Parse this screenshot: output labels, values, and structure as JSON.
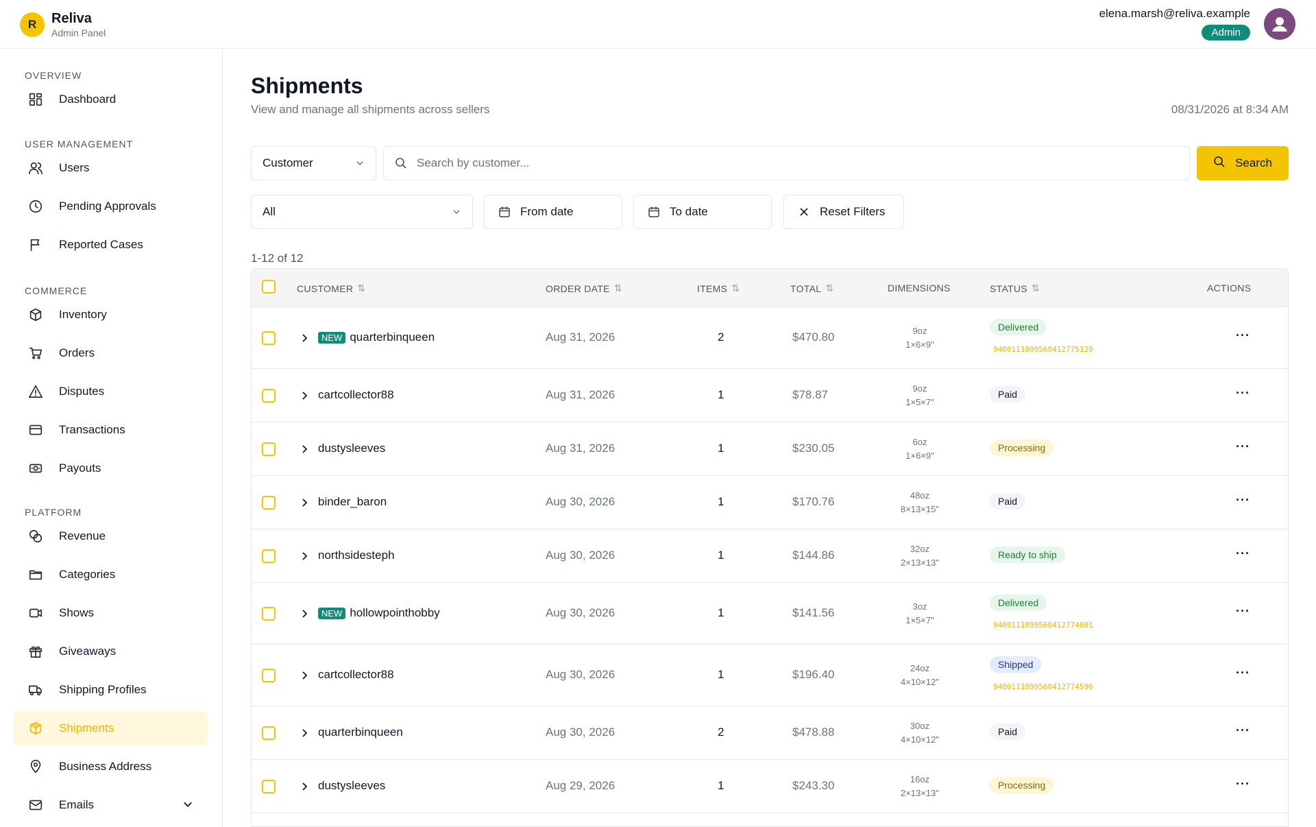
{
  "brand": {
    "logo_letter": "R",
    "name": "Reliva",
    "subtitle": "Admin Panel"
  },
  "user": {
    "email": "elena.marsh@reliva.example",
    "role": "Admin"
  },
  "sidebar": {
    "sections": [
      {
        "label": "OVERVIEW",
        "items": [
          {
            "label": "Dashboard",
            "icon": "dashboard-icon"
          }
        ]
      },
      {
        "label": "USER MANAGEMENT",
        "items": [
          {
            "label": "Users",
            "icon": "users-icon"
          },
          {
            "label": "Pending Approvals",
            "icon": "clock-icon"
          },
          {
            "label": "Reported Cases",
            "icon": "flag-icon"
          }
        ]
      },
      {
        "label": "COMMERCE",
        "items": [
          {
            "label": "Inventory",
            "icon": "box-icon"
          },
          {
            "label": "Orders",
            "icon": "cart-icon"
          },
          {
            "label": "Disputes",
            "icon": "warning-icon"
          },
          {
            "label": "Transactions",
            "icon": "card-icon"
          },
          {
            "label": "Payouts",
            "icon": "cash-icon"
          }
        ]
      },
      {
        "label": "PLATFORM",
        "items": [
          {
            "label": "Revenue",
            "icon": "coins-icon"
          },
          {
            "label": "Categories",
            "icon": "folder-icon"
          },
          {
            "label": "Shows",
            "icon": "video-icon"
          },
          {
            "label": "Giveaways",
            "icon": "gift-icon"
          },
          {
            "label": "Shipping Profiles",
            "icon": "truck-icon"
          },
          {
            "label": "Shipments",
            "icon": "package-icon",
            "active": true
          },
          {
            "label": "Business Address",
            "icon": "pin-icon"
          },
          {
            "label": "Emails",
            "icon": "mail-icon",
            "expandable": true
          }
        ]
      }
    ]
  },
  "page": {
    "title": "Shipments",
    "subtitle": "View and manage all shipments across sellers",
    "timestamp": "08/31/2026 at 8:34 AM"
  },
  "filters": {
    "search_by": "Customer",
    "search_placeholder": "Search by customer...",
    "search_button": "Search",
    "status": "All",
    "from_date": "From date",
    "to_date": "To date",
    "reset": "Reset Filters"
  },
  "table": {
    "count_label": "1-12 of 12",
    "headers": {
      "customer": "CUSTOMER",
      "order_date": "ORDER DATE",
      "items": "ITEMS",
      "total": "TOTAL",
      "dimensions": "DIMENSIONS",
      "status": "STATUS",
      "actions": "ACTIONS"
    },
    "rows": [
      {
        "new": true,
        "customer": "quarterbinqueen",
        "date": "Aug 31, 2026",
        "items": "2",
        "total": "$470.80",
        "weight": "9oz",
        "size": "1×6×9\"",
        "status": "Delivered",
        "tracking": "9400111899560412775129"
      },
      {
        "new": false,
        "customer": "cartcollector88",
        "date": "Aug 31, 2026",
        "items": "1",
        "total": "$78.87",
        "weight": "9oz",
        "size": "1×5×7\"",
        "status": "Paid",
        "tracking": ""
      },
      {
        "new": false,
        "customer": "dustysleeves",
        "date": "Aug 31, 2026",
        "items": "1",
        "total": "$230.05",
        "weight": "6oz",
        "size": "1×6×9\"",
        "status": "Processing",
        "tracking": ""
      },
      {
        "new": false,
        "customer": "binder_baron",
        "date": "Aug 30, 2026",
        "items": "1",
        "total": "$170.76",
        "weight": "48oz",
        "size": "8×13×15\"",
        "status": "Paid",
        "tracking": ""
      },
      {
        "new": false,
        "customer": "northsidesteph",
        "date": "Aug 30, 2026",
        "items": "1",
        "total": "$144.86",
        "weight": "32oz",
        "size": "2×13×13\"",
        "status": "Ready to ship",
        "tracking": ""
      },
      {
        "new": true,
        "customer": "hollowpointhobby",
        "date": "Aug 30, 2026",
        "items": "1",
        "total": "$141.56",
        "weight": "3oz",
        "size": "1×5×7\"",
        "status": "Delivered",
        "tracking": "9400111899560412774801"
      },
      {
        "new": false,
        "customer": "cartcollector88",
        "date": "Aug 30, 2026",
        "items": "1",
        "total": "$196.40",
        "weight": "24oz",
        "size": "4×10×12\"",
        "status": "Shipped",
        "tracking": "9400111899560412774596"
      },
      {
        "new": false,
        "customer": "quarterbinqueen",
        "date": "Aug 30, 2026",
        "items": "2",
        "total": "$478.88",
        "weight": "30oz",
        "size": "4×10×12\"",
        "status": "Paid",
        "tracking": ""
      },
      {
        "new": false,
        "customer": "dustysleeves",
        "date": "Aug 29, 2026",
        "items": "1",
        "total": "$243.30",
        "weight": "16oz",
        "size": "2×13×13\"",
        "status": "Processing",
        "tracking": ""
      }
    ],
    "new_label": "NEW"
  },
  "colors": {
    "accent": "#f5c400",
    "teal": "#0f8c7a"
  }
}
